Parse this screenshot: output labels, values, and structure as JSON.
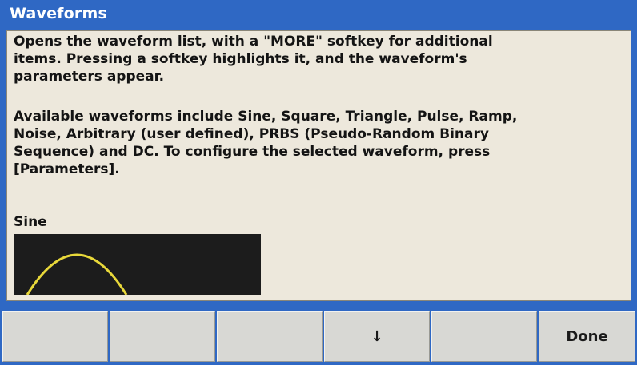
{
  "header": {
    "title": "Waveforms"
  },
  "help": {
    "paragraph_1": "Opens the waveform list, with a \"MORE\" softkey for additional\nitems. Pressing a softkey highlights it, and the waveform's\nparameters appear.",
    "paragraph_2": "Available waveforms include Sine, Square, Triangle, Pulse, Ramp,\nNoise, Arbitrary (user defined), PRBS (Pseudo-Random Binary\nSequence) and DC. To configure the selected waveform, press\n[Parameters]."
  },
  "preview": {
    "label": "Sine",
    "trace_color": "#e8d83a",
    "background_color": "#1c1c1c"
  },
  "softkeys": {
    "key_1": "",
    "key_2": "",
    "key_3": "",
    "key_4_icon": "down-arrow-icon",
    "key_4": "↓",
    "key_5": "",
    "key_6": "Done"
  },
  "colors": {
    "frame": "#2f68c4",
    "panel": "#ede8dc",
    "softkey": "#d8d8d4"
  }
}
